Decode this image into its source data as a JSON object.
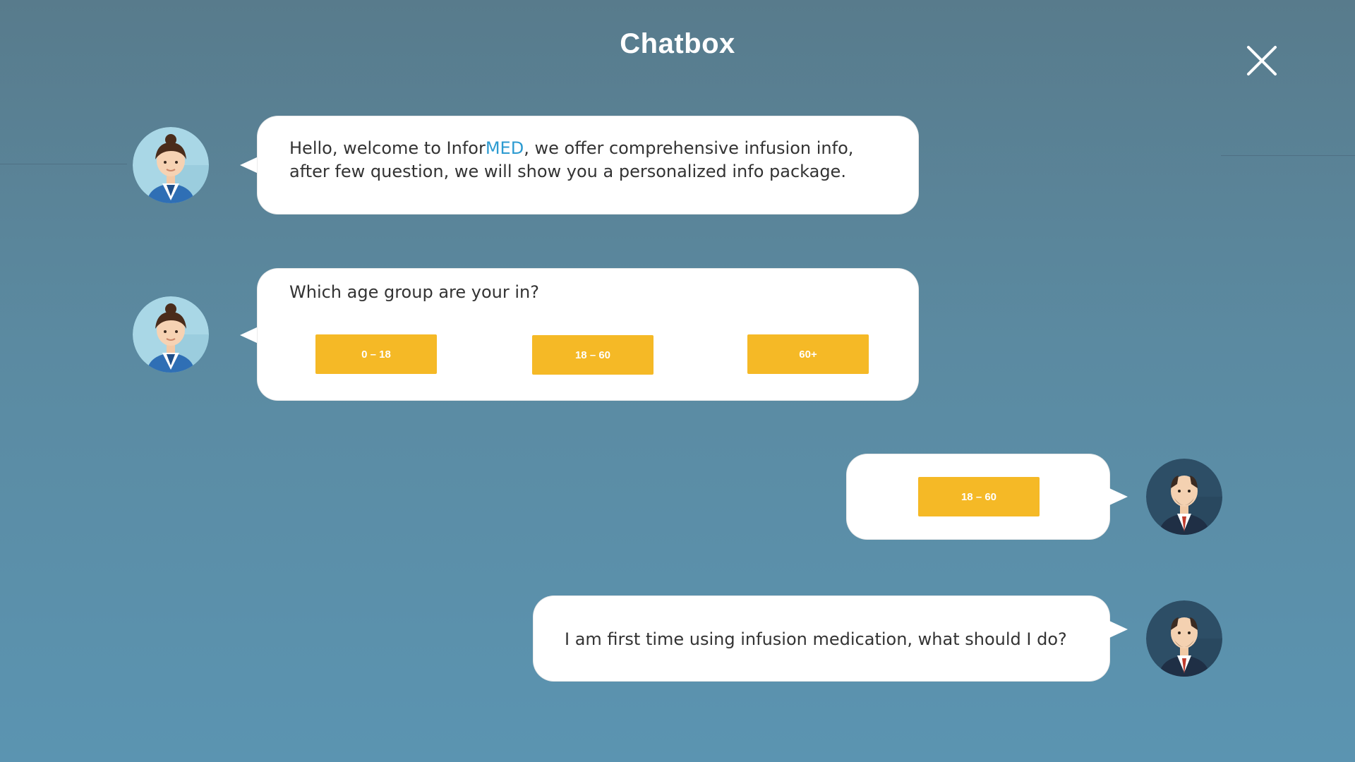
{
  "header": {
    "title": "Chatbox",
    "close_icon": "close-icon"
  },
  "colors": {
    "accent": "#2d9bd1",
    "option_button": "#f5b926",
    "bubble": "#ffffff"
  },
  "messages": [
    {
      "sender": "assistant",
      "text_before": "Hello, welcome to Infor",
      "brand_highlight": "MED",
      "text_after": ", we offer comprehensive infusion info, after few question, we will show you a personalized info package."
    },
    {
      "sender": "assistant",
      "question": "Which age group are your in?",
      "options": [
        "0 – 18",
        "18 – 60",
        "60+"
      ]
    },
    {
      "sender": "user",
      "selected_option": "18 – 60"
    },
    {
      "sender": "user",
      "text": "I am first time using infusion medication, what should I do?"
    }
  ]
}
